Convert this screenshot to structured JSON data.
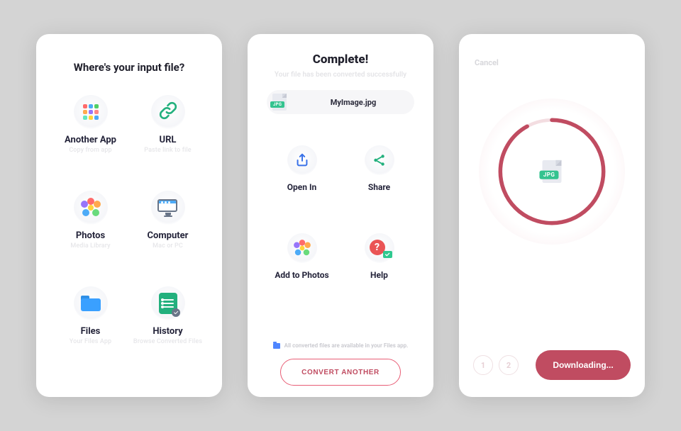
{
  "screen1": {
    "title": "Where's your input file?",
    "options": [
      {
        "label": "Another App",
        "sub": "Copy from app"
      },
      {
        "label": "URL",
        "sub": "Paste link to file"
      },
      {
        "label": "Photos",
        "sub": "Media Library"
      },
      {
        "label": "Computer",
        "sub": "Mac or PC"
      },
      {
        "label": "Files",
        "sub": "Your Files App"
      },
      {
        "label": "History",
        "sub": "Browse Converted Files"
      }
    ]
  },
  "screen2": {
    "title": "Complete!",
    "subtitle": "Your file has been converted successfully",
    "file": {
      "name": "MyImage.jpg",
      "badge": "JPG"
    },
    "actions": [
      {
        "label": "Open In"
      },
      {
        "label": "Share"
      },
      {
        "label": "Add to Photos"
      },
      {
        "label": "Help"
      }
    ],
    "note": "All converted files are available in your Files app.",
    "convert_another_label": "CONVERT ANOTHER"
  },
  "screen3": {
    "cancel_label": "Cancel",
    "file_badge": "JPG",
    "steps": [
      "1",
      "2"
    ],
    "download_button_label": "Downloading...",
    "progress_percent": 92
  },
  "colors": {
    "accent": "#c04c61",
    "green": "#34c38f"
  }
}
